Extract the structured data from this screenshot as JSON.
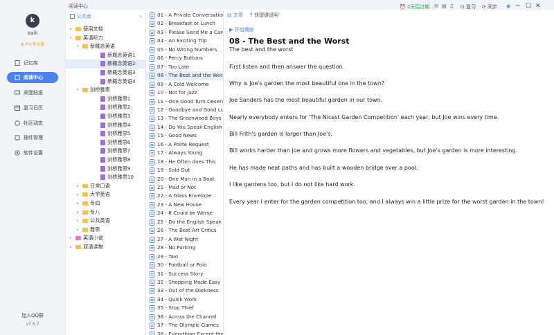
{
  "window": {
    "title": "阅读中心"
  },
  "user": {
    "initial": "k",
    "name": "kaili",
    "badge": "Pro专业版"
  },
  "nav": {
    "items": [
      {
        "label": "记忆库",
        "icon": "memory-icon"
      },
      {
        "label": "阅读中心",
        "icon": "reading-icon",
        "active": true
      },
      {
        "label": "桌面贴纸",
        "icon": "sticker-icon"
      },
      {
        "label": "复习日历",
        "icon": "calendar-icon"
      },
      {
        "label": "社区动态",
        "icon": "community-icon"
      },
      {
        "label": "插件管理",
        "icon": "plugin-icon"
      },
      {
        "label": "软件设置",
        "icon": "settings-icon"
      }
    ],
    "qq": "加入QQ群",
    "version": "v7.5.7"
  },
  "tree": {
    "header": "公共库",
    "rows": [
      {
        "label": "使用文档",
        "level": 0,
        "type": "folder",
        "caret": "▸"
      },
      {
        "label": "英语听力",
        "level": 0,
        "type": "folder",
        "caret": "▾"
      },
      {
        "label": "新概念英语",
        "level": 1,
        "type": "folder",
        "caret": "▾"
      },
      {
        "label": "新概念英语1",
        "level": 2,
        "type": "book"
      },
      {
        "label": "新概念英语2",
        "level": 2,
        "type": "book",
        "selected": true
      },
      {
        "label": "新概念英语3",
        "level": 2,
        "type": "book"
      },
      {
        "label": "新概念英语4",
        "level": 2,
        "type": "book"
      },
      {
        "label": "剑桥雅思",
        "level": 1,
        "type": "folder",
        "caret": "▾"
      },
      {
        "label": "剑桥雅思1",
        "level": 2,
        "type": "book"
      },
      {
        "label": "剑桥雅思2",
        "level": 2,
        "type": "book"
      },
      {
        "label": "剑桥雅思3",
        "level": 2,
        "type": "book"
      },
      {
        "label": "剑桥雅思4",
        "level": 2,
        "type": "book"
      },
      {
        "label": "剑桥雅思5",
        "level": 2,
        "type": "book"
      },
      {
        "label": "剑桥雅思6",
        "level": 2,
        "type": "book"
      },
      {
        "label": "剑桥雅思7",
        "level": 2,
        "type": "book"
      },
      {
        "label": "剑桥雅思8",
        "level": 2,
        "type": "book"
      },
      {
        "label": "剑桥雅思9",
        "level": 2,
        "type": "book"
      },
      {
        "label": "剑桥雅思10",
        "level": 2,
        "type": "book"
      },
      {
        "label": "日常口语",
        "level": 1,
        "type": "folder",
        "caret": "▸"
      },
      {
        "label": "大学英语",
        "level": 1,
        "type": "folder",
        "caret": "▸"
      },
      {
        "label": "专四",
        "level": 1,
        "type": "folder",
        "caret": "▸"
      },
      {
        "label": "专八",
        "level": 1,
        "type": "folder",
        "caret": "▸"
      },
      {
        "label": "公共英语",
        "level": 1,
        "type": "folder",
        "caret": "▸"
      },
      {
        "label": "雅思",
        "level": 1,
        "type": "folder",
        "caret": "▸"
      },
      {
        "label": "英语小说",
        "level": 0,
        "type": "folder-pink",
        "caret": "▸"
      },
      {
        "label": "双语读物",
        "level": 0,
        "type": "folder",
        "caret": "▸"
      }
    ]
  },
  "doclist": [
    "01 - A Private Conversation",
    "02 - Breakfast or Lunch",
    "03 - Please Send Me a Card",
    "04 - An Exciting Trip",
    "05 - No Wrong Numbers",
    "06 - Percy Buttons",
    "07 - Too Late",
    "08 - The Best and the Worst",
    "09 - A Cold Welcome",
    "10 - Not for Jazz",
    "11 - One Good Turn Deserve",
    "12 - Goodbye and Good Luc",
    "13 - The Greenwood Boys",
    "14 - Do You Speak English",
    "15 - Good News",
    "16 - A Polite Request",
    "17 - Always Young",
    "18 - He Often does This",
    "19 - Sold Out",
    "20 - One Man in a Boat",
    "21 - Mad or Not",
    "22 - A Glass Envelope",
    "23 - A New House",
    "24 - It Could be Worse",
    "25 - Do the English Speak E",
    "26 - The Best Art Critics",
    "27 - A Wet Night",
    "28 - No Parking",
    "29 - Taxi",
    "30 - Football or Polo",
    "31 - Success Story",
    "32 - Shopping Made Easy",
    "33 - Out of the Darkness",
    "34 - Quick Work",
    "35 - Stop Thief",
    "36 - Across the Channel",
    "37 - The Olympic Games",
    "38 - Everything Except the W"
  ],
  "doclist_selected_index": 7,
  "content": {
    "tabs": [
      "文章",
      "快捷键说明"
    ],
    "play": "开始播放",
    "title": "08 - The Best and the Worst",
    "subtitle": "The best and the worst",
    "paragraphs": [
      "First listen and then answer the question.",
      "Why is Joe's garden the most beautiful one in the town?",
      "Joe Sanders has the most beautiful garden in our town.",
      "Nearly everybody enters for 'The Nicest Garden Competition' each year, but Joe wins every time.",
      "Bill Frith's garden is larger than Joe's.",
      "Bill works harder than Joe and grows more flowers and vegetables, but Joe's garden is more interesting.",
      "He has made neat paths and has built a wooden bridge over a pool.",
      "I like gardens too, but I do not like hard work.",
      "Every year I enter for the garden competition too, and I always win a little prize for the worst garden in the town!"
    ]
  },
  "topbar": {
    "expire": "2天后过期",
    "review": "复习",
    "sync": "同步"
  },
  "colors": {
    "accent": "#4b84f0",
    "expire": "#1f9f4a",
    "folder": "#f5c242",
    "book": "#9b6ee6"
  }
}
